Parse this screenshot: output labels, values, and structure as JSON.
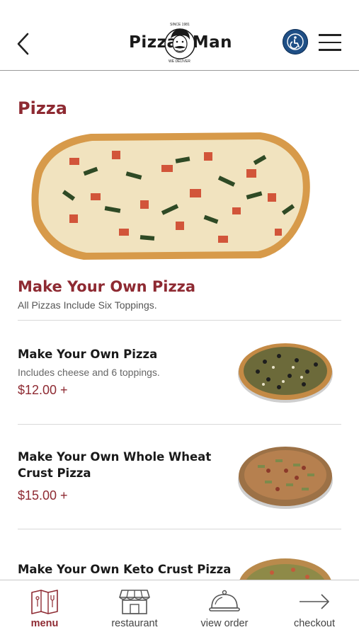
{
  "header": {
    "logo": {
      "left": "Pizza",
      "right": "Man",
      "since": "SINCE 1981",
      "tagline": "WE DELIVER"
    },
    "accessibility_label": "Accessibility",
    "menu_label": "Menu"
  },
  "category": {
    "title": "Pizza"
  },
  "section": {
    "title": "Make Your Own Pizza",
    "subtitle": "All Pizzas Include Six Toppings."
  },
  "items": [
    {
      "title": "Make Your Own Pizza",
      "description": "Includes cheese and 6 toppings.",
      "price": "$12.00 +"
    },
    {
      "title": "Make Your Own Whole Wheat Crust Pizza",
      "description": "",
      "price": "$15.00 +"
    },
    {
      "title": "Make Your Own Keto Crust Pizza",
      "description": "",
      "price": ""
    }
  ],
  "bottom_nav": [
    {
      "label": "menu",
      "icon": "menu-book-icon",
      "active": true
    },
    {
      "label": "restaurant",
      "icon": "storefront-icon",
      "active": false
    },
    {
      "label": "view order",
      "icon": "cloche-icon",
      "active": false
    },
    {
      "label": "checkout",
      "icon": "arrow-right-icon",
      "active": false
    }
  ],
  "colors": {
    "accent": "#8e2a32",
    "accessibility": "#1f4f86"
  }
}
